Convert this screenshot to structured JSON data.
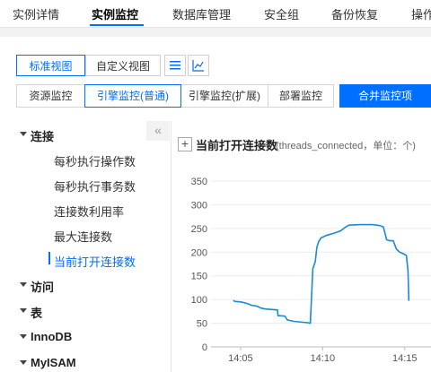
{
  "top_tabs": [
    {
      "label": "实例详情",
      "active": false
    },
    {
      "label": "实例监控",
      "active": true
    },
    {
      "label": "数据库管理",
      "active": false
    },
    {
      "label": "安全组",
      "active": false
    },
    {
      "label": "备份恢复",
      "active": false
    },
    {
      "label": "操作",
      "active": false
    }
  ],
  "view_toggle": {
    "standard": "标准视图",
    "custom": "自定义视图",
    "list_icon": "list-icon",
    "chart_icon": "line-chart-icon"
  },
  "monitor_types": [
    {
      "label": "资源监控",
      "active": false
    },
    {
      "label": "引擎监控(普通)",
      "active": true
    },
    {
      "label": "引擎监控(扩展)",
      "active": false
    },
    {
      "label": "部署监控",
      "active": false
    }
  ],
  "merge_button": "合并监控项",
  "sidebar": {
    "collapse_icon": "«",
    "groups": [
      {
        "label": "连接",
        "expanded": true,
        "items": [
          {
            "label": "每秒执行操作数",
            "active": false
          },
          {
            "label": "每秒执行事务数",
            "active": false
          },
          {
            "label": "连接数利用率",
            "active": false
          },
          {
            "label": "最大连接数",
            "active": false
          },
          {
            "label": "当前打开连接数",
            "active": true
          }
        ]
      },
      {
        "label": "访问",
        "expanded": false,
        "items": []
      },
      {
        "label": "表",
        "expanded": false,
        "items": []
      },
      {
        "label": "InnoDB",
        "expanded": false,
        "items": []
      },
      {
        "label": "MyISAM",
        "expanded": false,
        "items": []
      }
    ]
  },
  "chart_header": {
    "plus": "+",
    "title": "当前打开连接数",
    "subtitle": "(threads_connected，单位：个)"
  },
  "chart_data": {
    "type": "line",
    "title": "当前打开连接数",
    "subtitle": "(threads_connected，单位：个)",
    "ylim": [
      0,
      350
    ],
    "yticks": [
      0,
      50,
      100,
      150,
      200,
      250,
      300,
      350
    ],
    "xticks": [
      "14:05",
      "14:10",
      "14:15"
    ],
    "grid": true,
    "color": "#1a8ad9",
    "series": [
      {
        "values": [
          [
            14.05,
            98
          ],
          [
            14.17,
            96
          ],
          [
            14.5,
            95
          ],
          [
            14.75,
            93
          ],
          [
            14.95,
            91
          ],
          [
            15.15,
            88
          ],
          [
            15.5,
            86
          ],
          [
            15.75,
            82
          ],
          [
            16.0,
            80
          ],
          [
            16.75,
            78
          ],
          [
            16.78,
            66
          ],
          [
            17.2,
            65
          ],
          [
            17.35,
            57
          ],
          [
            17.75,
            54
          ],
          [
            18.3,
            52
          ],
          [
            18.6,
            51
          ],
          [
            18.75,
            50
          ],
          [
            18.9,
            165
          ],
          [
            19.05,
            180
          ],
          [
            19.15,
            210
          ],
          [
            19.25,
            222
          ],
          [
            19.4,
            230
          ],
          [
            19.7,
            235
          ],
          [
            20.2,
            240
          ],
          [
            20.6,
            245
          ],
          [
            20.9,
            253
          ],
          [
            21.1,
            257
          ],
          [
            21.8,
            258
          ],
          [
            22.5,
            258
          ],
          [
            23.0,
            256
          ],
          [
            23.2,
            253
          ],
          [
            23.4,
            226
          ],
          [
            23.6,
            224
          ],
          [
            23.8,
            224
          ],
          [
            24.0,
            206
          ],
          [
            24.2,
            200
          ],
          [
            24.4,
            197
          ],
          [
            24.6,
            193
          ],
          [
            24.7,
            160
          ],
          [
            24.75,
            97
          ]
        ]
      }
    ]
  }
}
